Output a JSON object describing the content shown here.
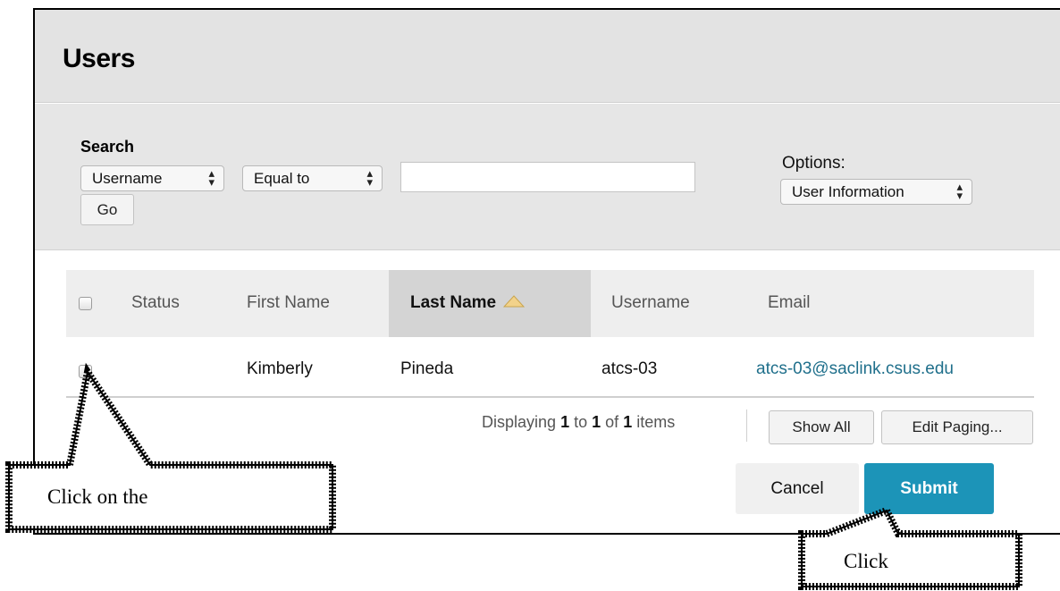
{
  "page": {
    "title": "Users"
  },
  "search": {
    "label": "Search",
    "field_select": "Username",
    "operator_select": "Equal to",
    "value": "",
    "go_label": "Go",
    "options_label": "Options:",
    "options_select": "User Information"
  },
  "table": {
    "columns": [
      "Status",
      "First Name",
      "Last Name",
      "Username",
      "Email"
    ],
    "sorted_column": "Last Name",
    "sort_direction": "ascending",
    "rows": [
      {
        "status": "",
        "first_name": "Kimberly",
        "last_name": "Pineda",
        "username": "atcs-03",
        "email": "atcs-03@saclink.csus.edu",
        "checked": false
      }
    ]
  },
  "paging": {
    "prefix": "Displaying",
    "from": "1",
    "to_word": "to",
    "to": "1",
    "of_word": "of",
    "total": "1",
    "suffix": "items",
    "show_all_label": "Show All",
    "edit_paging_label": "Edit Paging..."
  },
  "actions": {
    "cancel_label": "Cancel",
    "submit_label": "Submit"
  },
  "callouts": {
    "left_text": "Click on the",
    "right_text": "Click"
  },
  "colors": {
    "submit": "#1c94b8",
    "email_link": "#1f6f8b",
    "sort_arrow": "#f2d28a"
  }
}
